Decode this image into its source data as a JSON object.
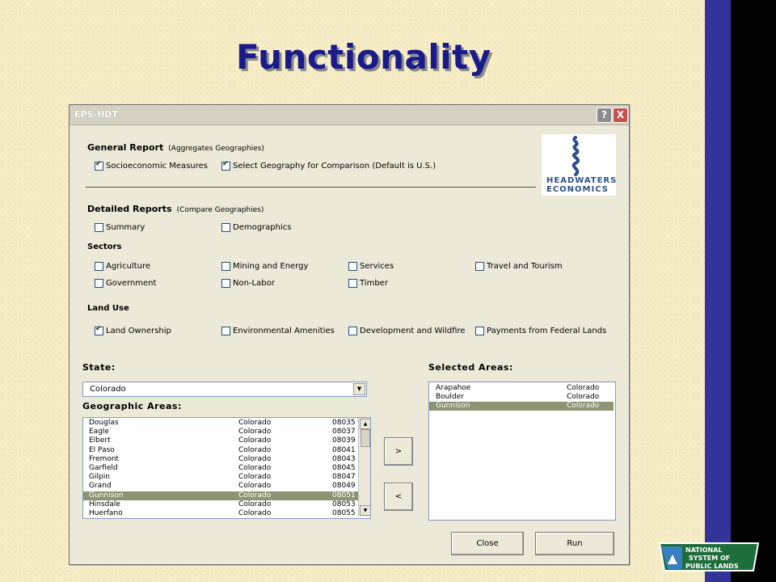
{
  "slide": {
    "title": "Functionality",
    "bar_color": "#333399",
    "title_color": "#1a1a8c"
  },
  "window": {
    "title": "EPS-HDT",
    "help": "?",
    "close": "X"
  },
  "general_report": {
    "heading": "General Report",
    "note": "(Aggregates Geographies)",
    "options": [
      {
        "label": "Socioeconomic Measures",
        "checked": true
      },
      {
        "label": "Select Geography for Comparison (Default is U.S.)",
        "checked": true
      }
    ]
  },
  "logo": {
    "line1": "HEADWATERS",
    "line2": "ECONOMICS",
    "color": "#2b4f8c"
  },
  "detailed_reports": {
    "heading": "Detailed Reports",
    "note": "(Compare Geographies)",
    "options": [
      {
        "label": "Summary",
        "checked": false
      },
      {
        "label": "Demographics",
        "checked": false
      }
    ]
  },
  "sectors": {
    "heading": "Sectors",
    "options": [
      {
        "label": "Agriculture",
        "checked": false
      },
      {
        "label": "Mining and Energy",
        "checked": false
      },
      {
        "label": "Services",
        "checked": false
      },
      {
        "label": "Travel and Tourism",
        "checked": false
      },
      {
        "label": "Government",
        "checked": false
      },
      {
        "label": "Non-Labor",
        "checked": false
      },
      {
        "label": "Timber",
        "checked": false
      }
    ]
  },
  "land_use": {
    "heading": "Land Use",
    "options": [
      {
        "label": "Land Ownership",
        "checked": true
      },
      {
        "label": "Environmental Amenities",
        "checked": false
      },
      {
        "label": "Development and Wildfire",
        "checked": false
      },
      {
        "label": "Payments from Federal Lands",
        "checked": false
      }
    ]
  },
  "state": {
    "label": "State:",
    "value": "Colorado"
  },
  "geographic_areas": {
    "label": "Geographic Areas:",
    "rows": [
      {
        "name": "Douglas",
        "state": "Colorado",
        "code": "08035",
        "selected": false
      },
      {
        "name": "Eagle",
        "state": "Colorado",
        "code": "08037",
        "selected": false
      },
      {
        "name": "Elbert",
        "state": "Colorado",
        "code": "08039",
        "selected": false
      },
      {
        "name": "El Paso",
        "state": "Colorado",
        "code": "08041",
        "selected": false
      },
      {
        "name": "Fremont",
        "state": "Colorado",
        "code": "08043",
        "selected": false
      },
      {
        "name": "Garfield",
        "state": "Colorado",
        "code": "08045",
        "selected": false
      },
      {
        "name": "Gilpin",
        "state": "Colorado",
        "code": "08047",
        "selected": false
      },
      {
        "name": "Grand",
        "state": "Colorado",
        "code": "08049",
        "selected": false
      },
      {
        "name": "Gunnison",
        "state": "Colorado",
        "code": "08051",
        "selected": true
      },
      {
        "name": "Hinsdale",
        "state": "Colorado",
        "code": "08053",
        "selected": false
      },
      {
        "name": "Huerfano",
        "state": "Colorado",
        "code": "08055",
        "selected": false
      }
    ]
  },
  "selected_areas": {
    "label": "Selected Areas:",
    "rows": [
      {
        "name": "Arapahoe",
        "state": "Colorado",
        "selected": false
      },
      {
        "name": "Boulder",
        "state": "Colorado",
        "selected": false
      },
      {
        "name": "Gunnison",
        "state": "Colorado",
        "selected": true
      }
    ]
  },
  "buttons": {
    "add": ">",
    "remove": "<",
    "close": "Close",
    "run": "Run"
  },
  "badge": {
    "line1": "NATIONAL",
    "line2": "SYSTEM OF",
    "line3": "PUBLIC LANDS"
  }
}
